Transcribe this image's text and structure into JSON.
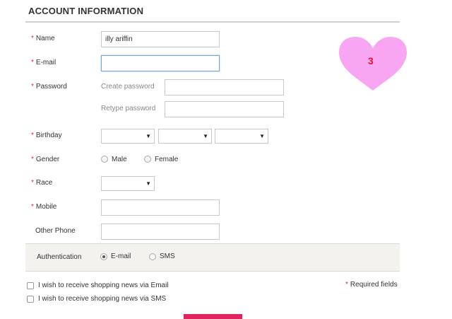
{
  "section_title": "ACCOUNT INFORMATION",
  "required_mark": "*",
  "colors": {
    "accent": "#e0245e",
    "heart": "#f9a6f2",
    "heart_number": "#e0142f"
  },
  "fields": {
    "name": {
      "label": "Name",
      "value": "illy ariffin"
    },
    "email": {
      "label": "E-mail",
      "value": ""
    },
    "password": {
      "label": "Password",
      "create_label": "Create password",
      "retype_label": "Retype password",
      "value": "",
      "retype_value": ""
    },
    "birthday": {
      "label": "Birthday",
      "day": "",
      "month": "",
      "year": ""
    },
    "gender": {
      "label": "Gender",
      "options": [
        "Male",
        "Female"
      ],
      "selected": ""
    },
    "race": {
      "label": "Race",
      "value": ""
    },
    "mobile": {
      "label": "Mobile",
      "value": ""
    },
    "other_phone": {
      "label": "Other Phone",
      "value": ""
    }
  },
  "authentication": {
    "label": "Authentication",
    "options": [
      "E-mail",
      "SMS"
    ],
    "selected": "E-mail"
  },
  "subscriptions": [
    {
      "label": "I wish to receive shopping news via Email",
      "checked": false
    },
    {
      "label": "I wish to receive shopping news via SMS",
      "checked": false
    }
  ],
  "required_note": "Required fields",
  "heart_badge": {
    "icon": "heart-icon",
    "value": "3"
  }
}
